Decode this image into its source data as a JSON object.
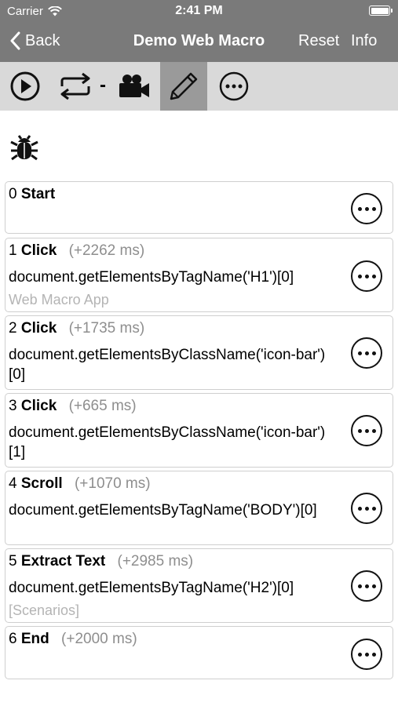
{
  "status": {
    "carrier": "Carrier",
    "time": "2:41 PM",
    "battery_level": 1.0
  },
  "nav": {
    "back_label": "Back",
    "title": "Demo Web Macro",
    "reset_label": "Reset",
    "info_label": "Info"
  },
  "toolbar": {
    "separator": "-",
    "icons": [
      "play-icon",
      "repeat-icon",
      "video-camera-icon",
      "pencil-icon",
      "more-icon"
    ],
    "active": "pencil-icon"
  },
  "steps": [
    {
      "index": "0",
      "action": "Start",
      "delay": "",
      "target": "",
      "note": ""
    },
    {
      "index": "1",
      "action": "Click",
      "delay": "(+2262 ms)",
      "target": "document.getElementsByTagName('H1')[0]",
      "note": "Web Macro App"
    },
    {
      "index": "2",
      "action": "Click",
      "delay": "(+1735 ms)",
      "target": "document.getElementsByClassName('icon-bar')[0]",
      "note": ""
    },
    {
      "index": "3",
      "action": "Click",
      "delay": "(+665 ms)",
      "target": "document.getElementsByClassName('icon-bar')[1]",
      "note": ""
    },
    {
      "index": "4",
      "action": "Scroll",
      "delay": "(+1070 ms)",
      "target": "document.getElementsByTagName('BODY')[0]",
      "note": ""
    },
    {
      "index": "5",
      "action": "Extract Text",
      "delay": "(+2985 ms)",
      "target": "document.getElementsByTagName('H2')[0]",
      "note": "[Scenarios]"
    },
    {
      "index": "6",
      "action": "End",
      "delay": "(+2000 ms)",
      "target": "",
      "note": ""
    }
  ]
}
